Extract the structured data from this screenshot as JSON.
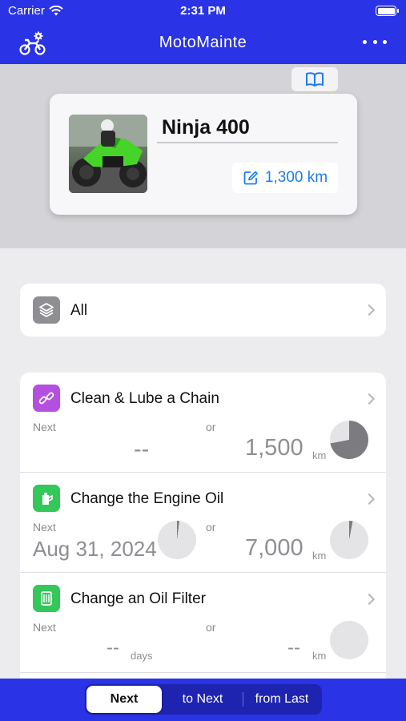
{
  "status_bar": {
    "carrier": "Carrier",
    "time": "2:31 PM"
  },
  "nav": {
    "title": "MotoMainte",
    "left_icon": "motorcycle-gear-icon",
    "right_icon": "more-dots-icon"
  },
  "bike": {
    "name": "Ninja 400",
    "odometer": "1,300 km"
  },
  "filter": {
    "label": "All"
  },
  "colors": {
    "brand_blue": "#2a33e6",
    "chain_purple": "#b44fe0",
    "oil_green": "#34c759",
    "link_blue": "#1c7cf2"
  },
  "items": [
    {
      "title": "Clean & Lube a Chain",
      "next_label": "Next",
      "or_label": "or",
      "date_value": "--",
      "distance_value": "1,500",
      "distance_unit": "km",
      "distance_progress": 0.72
    },
    {
      "title": "Change the Engine Oil",
      "next_label": "Next",
      "or_label": "or",
      "date_value": "Aug 31, 2024",
      "distance_value": "7,000",
      "distance_unit": "km",
      "date_progress": 0.02,
      "distance_progress": 0.03
    },
    {
      "title": "Change an Oil Filter",
      "next_label": "Next",
      "or_label": "or",
      "date_value": "--",
      "date_unit": "days",
      "distance_value": "--",
      "distance_unit": "km"
    }
  ],
  "segment": {
    "options": [
      "Next",
      "to Next",
      "from Last"
    ],
    "selected": "Next"
  }
}
